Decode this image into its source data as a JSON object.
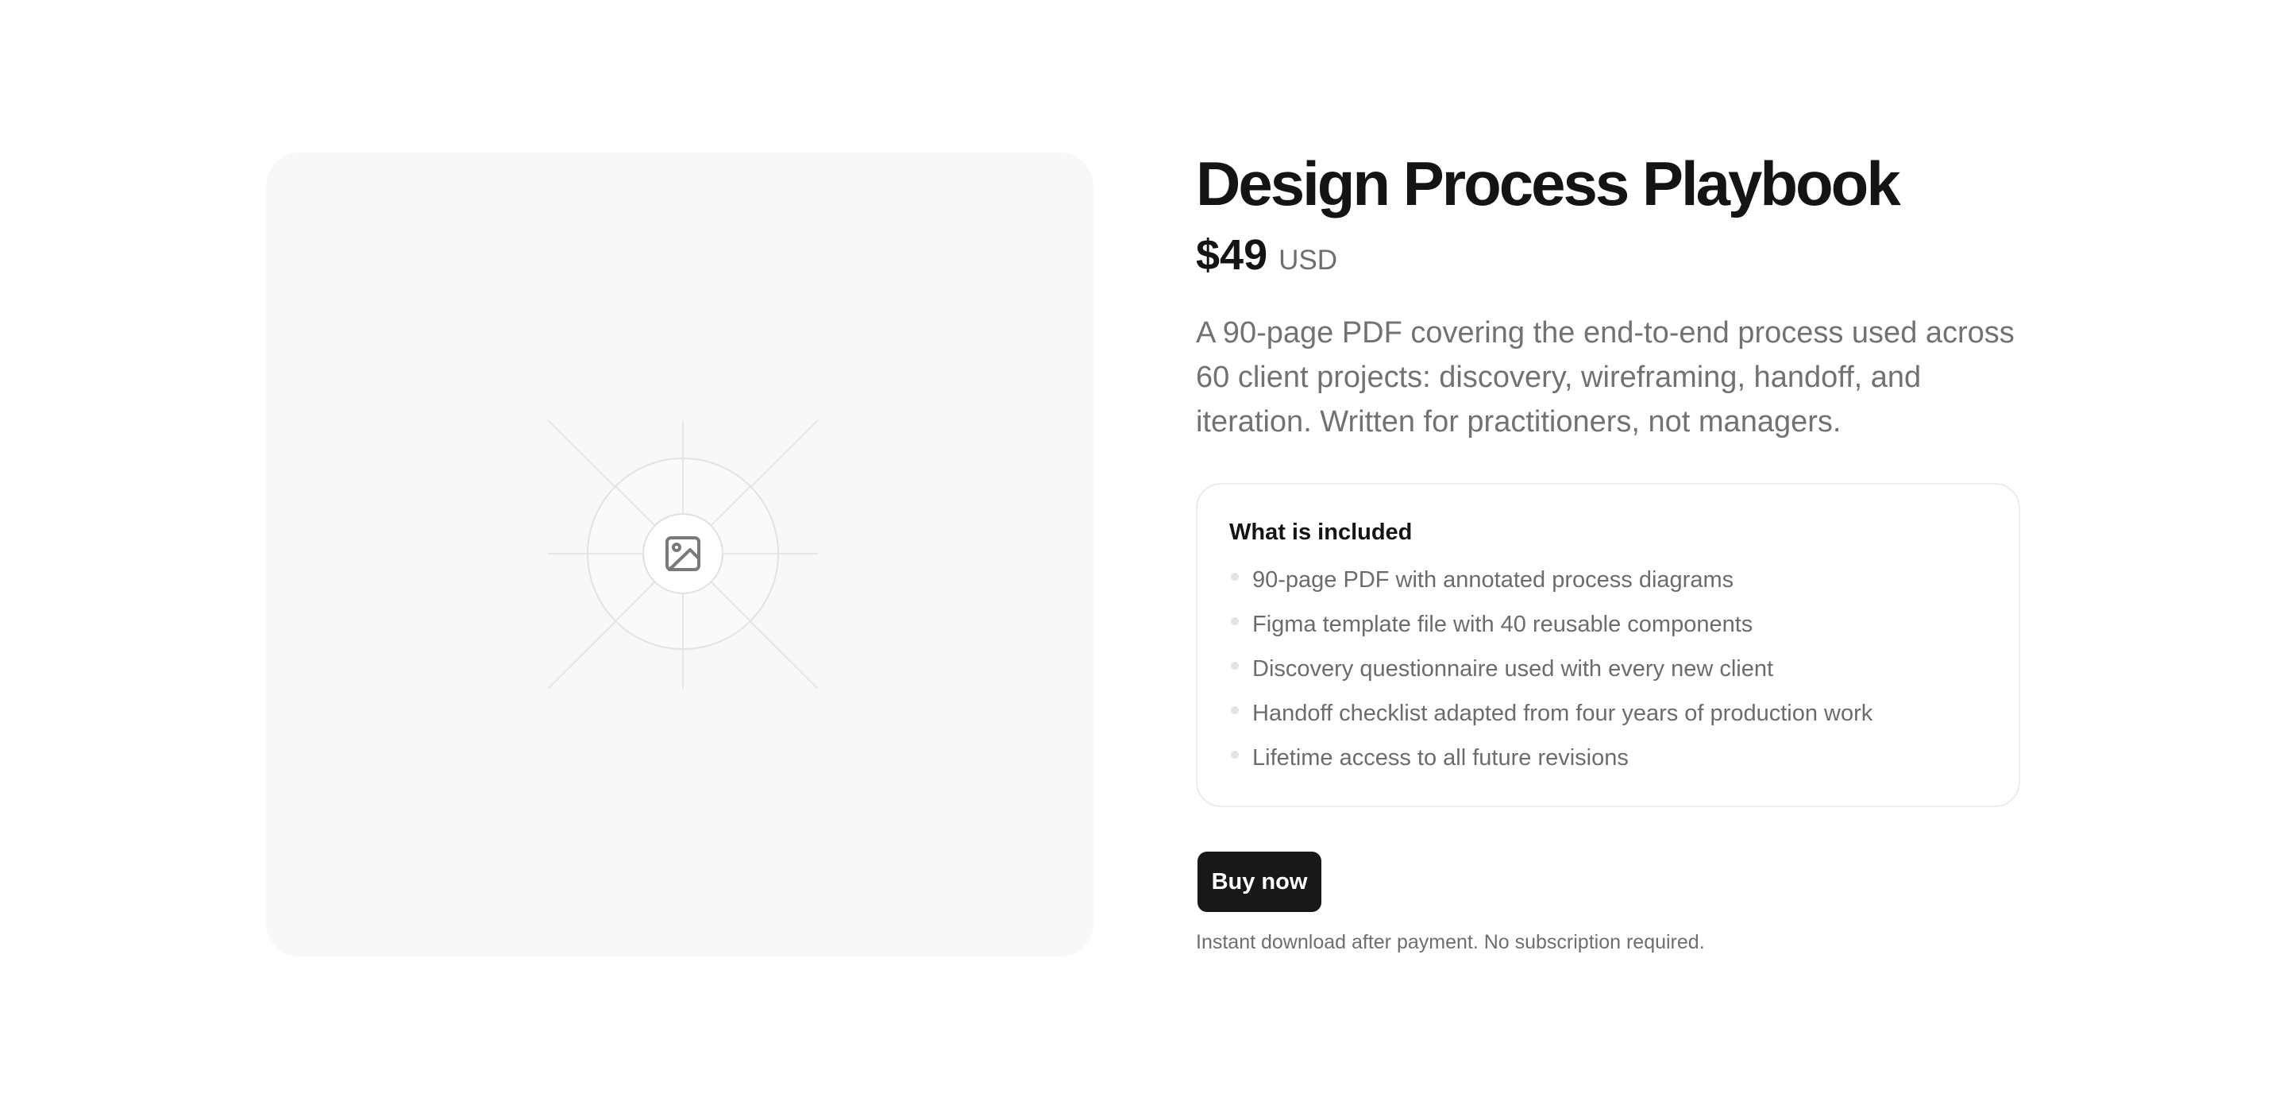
{
  "product": {
    "title": "Design Process Playbook",
    "price": "$49",
    "currency": "USD",
    "description": "A 90-page PDF covering the end-to-end process used across 60 client projects: discovery, wireframing, handoff, and iteration. Written for practitioners, not managers."
  },
  "image_placeholder": {
    "icon": "image-icon"
  },
  "included": {
    "title": "What is included",
    "items": [
      "90-page PDF with annotated process diagrams",
      "Figma template file with 40 reusable components",
      "Discovery questionnaire used with every new client",
      "Handoff checklist adapted from four years of production work",
      "Lifetime access to all future revisions"
    ]
  },
  "cta": {
    "buy_label": "Buy now",
    "note": "Instant download after payment. No subscription required."
  },
  "colors": {
    "background": "#ffffff",
    "text_primary": "#141414",
    "text_secondary": "#727272",
    "button_bg": "#181818",
    "button_text": "#ffffff",
    "placeholder_bg": "#f8f8f8",
    "border": "#ececec"
  }
}
